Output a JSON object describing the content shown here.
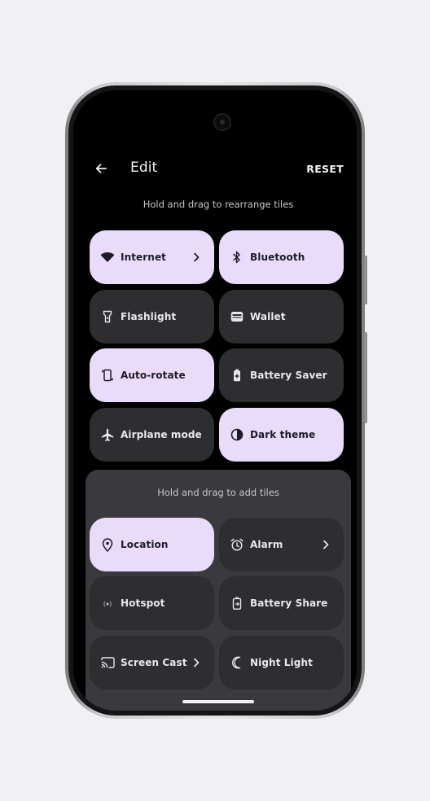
{
  "header": {
    "title": "Edit",
    "reset_label": "RESET"
  },
  "current_tiles": {
    "hint": "Hold and drag to rearrange tiles",
    "tiles": [
      {
        "label": "Internet",
        "icon": "wifi-icon",
        "active": true,
        "chevron": true
      },
      {
        "label": "Bluetooth",
        "icon": "bluetooth-icon",
        "active": true,
        "chevron": false
      },
      {
        "label": "Flashlight",
        "icon": "flashlight-icon",
        "active": false,
        "chevron": false
      },
      {
        "label": "Wallet",
        "icon": "wallet-icon",
        "active": false,
        "chevron": false
      },
      {
        "label": "Auto-rotate",
        "icon": "auto-rotate-icon",
        "active": true,
        "chevron": false
      },
      {
        "label": "Battery Saver",
        "icon": "battery-saver-icon",
        "active": false,
        "chevron": false
      },
      {
        "label": "Airplane mode",
        "icon": "airplane-icon",
        "active": false,
        "chevron": false
      },
      {
        "label": "Dark theme",
        "icon": "dark-theme-icon",
        "active": true,
        "chevron": false
      }
    ]
  },
  "available_tiles": {
    "hint": "Hold and drag to add tiles",
    "tiles": [
      {
        "label": "Location",
        "icon": "location-icon",
        "active": true,
        "chevron": false
      },
      {
        "label": "Alarm",
        "icon": "alarm-icon",
        "active": false,
        "chevron": true
      },
      {
        "label": "Hotspot",
        "icon": "hotspot-icon",
        "active": false,
        "chevron": false
      },
      {
        "label": "Battery Share",
        "icon": "battery-share-icon",
        "active": false,
        "chevron": false
      },
      {
        "label": "Screen Cast",
        "icon": "screen-cast-icon",
        "active": false,
        "chevron": true
      },
      {
        "label": "Night Light",
        "icon": "night-light-icon",
        "active": false,
        "chevron": false
      }
    ]
  },
  "colors": {
    "tile_active": "#e8dcfa",
    "tile_inactive": "#2e2e31",
    "panel": "#3a393d",
    "screen": "#000000"
  }
}
